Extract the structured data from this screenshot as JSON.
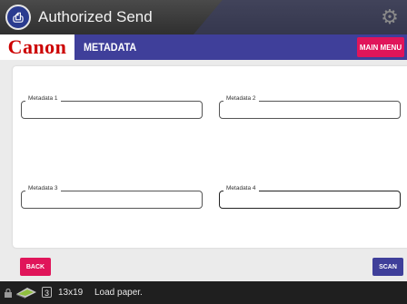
{
  "topbar": {
    "title": "Authorized Send",
    "app_icon": "authorized-send-icon",
    "settings_icon": "gear-icon"
  },
  "header": {
    "logo": "Canon",
    "section_title": "METADATA",
    "main_menu_label": "MAIN MENU"
  },
  "form": {
    "fields": [
      {
        "label": "Metadata 1",
        "value": ""
      },
      {
        "label": "Metadata 2",
        "value": ""
      },
      {
        "label": "Metadata 3",
        "value": ""
      },
      {
        "label": "Metadata 4",
        "value": ""
      }
    ]
  },
  "actions": {
    "back_label": "BACK",
    "scan_label": "SCAN"
  },
  "statusbar": {
    "count": "3",
    "paper_size": "13x19",
    "message": "Load paper."
  },
  "colors": {
    "accent_pink": "#e0155a",
    "header_blue": "#3f3f9a",
    "canon_red": "#cc0000"
  }
}
